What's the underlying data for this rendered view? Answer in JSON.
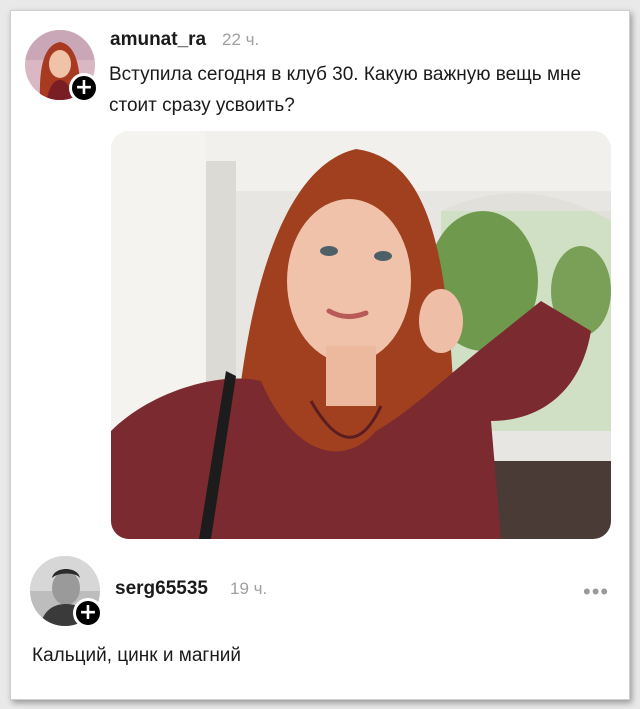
{
  "post": {
    "username": "amunat_ra",
    "time": "22 ч.",
    "text": "Вступила сегодня в клуб 30. Какую важную вещь мне стоит сразу усвоить?",
    "follow_glyph": "+"
  },
  "comment": {
    "username": "serg65535",
    "time": "19 ч.",
    "text": "Кальций, цинк и магний",
    "follow_glyph": "+",
    "more_glyph": "•••"
  },
  "colors": {
    "text": "#1a1a1a",
    "muted": "#a0a0a0",
    "card": "#ffffff"
  }
}
